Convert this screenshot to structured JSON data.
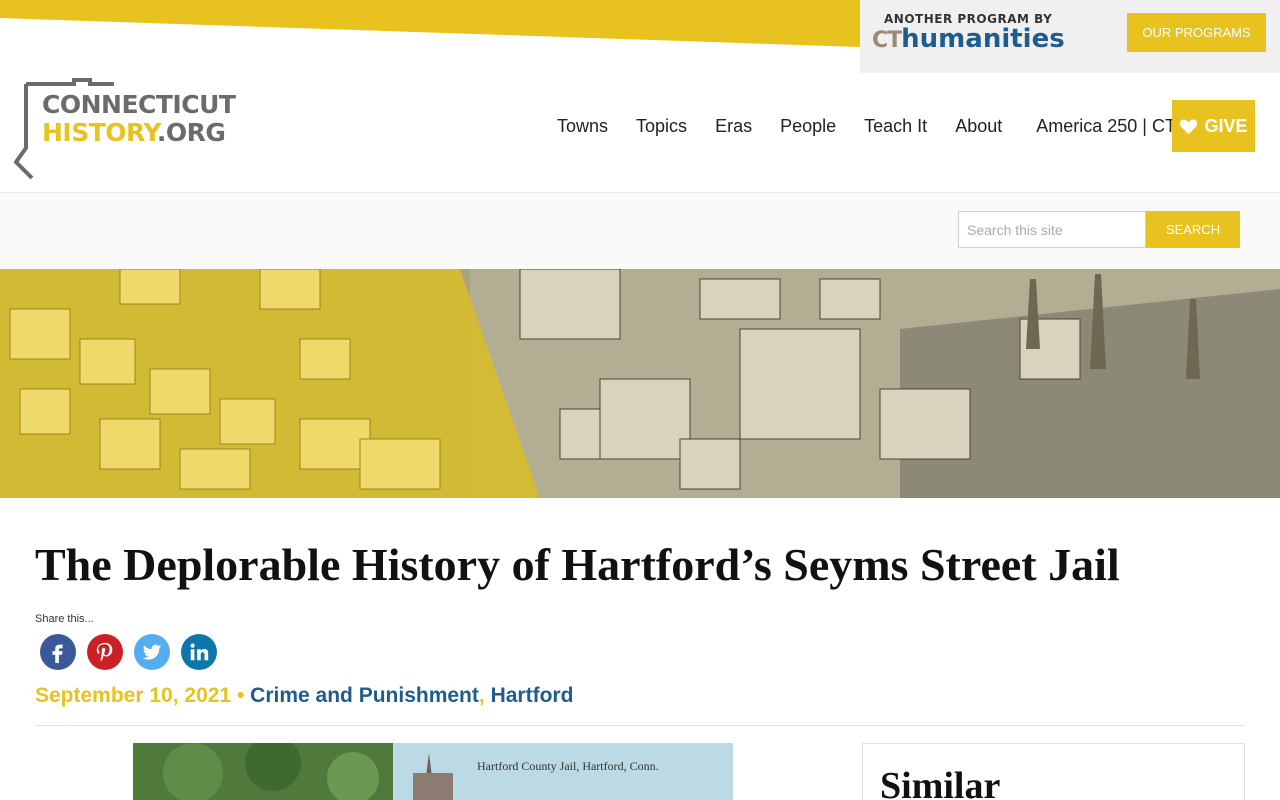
{
  "brand": {
    "accent": "#e8c21f",
    "blue": "#1f5c8e",
    "logo_line1": "CONNECTICUT",
    "logo_line2_a": "HISTORY",
    "logo_line2_b": ".ORG"
  },
  "promo": {
    "pre": "ANOTHER PROGRAM BY",
    "logo_ct": "CT",
    "logo_humanities": "humanities",
    "programs_label": "OUR PROGRAMS"
  },
  "nav": {
    "items": [
      "Towns",
      "Topics",
      "Eras",
      "People",
      "Teach It",
      "About",
      "America 250 | CT"
    ],
    "give_label": "GIVE"
  },
  "search": {
    "placeholder": "Search this site",
    "button_label": "SEARCH"
  },
  "article": {
    "title": "The Deplorable History of Hartford’s Seyms Street Jail",
    "share_label": "Share this...",
    "share_icons": [
      "facebook-icon",
      "pinterest-icon",
      "twitter-icon",
      "linkedin-icon"
    ],
    "date": "September 10, 2021",
    "bullet": "•",
    "categories": [
      "Crime and Punishment",
      "Hartford"
    ],
    "comma": ",",
    "image_caption": "Hartford County Jail, Hartford, Conn."
  },
  "sidebar": {
    "similar_title": "Similar"
  }
}
